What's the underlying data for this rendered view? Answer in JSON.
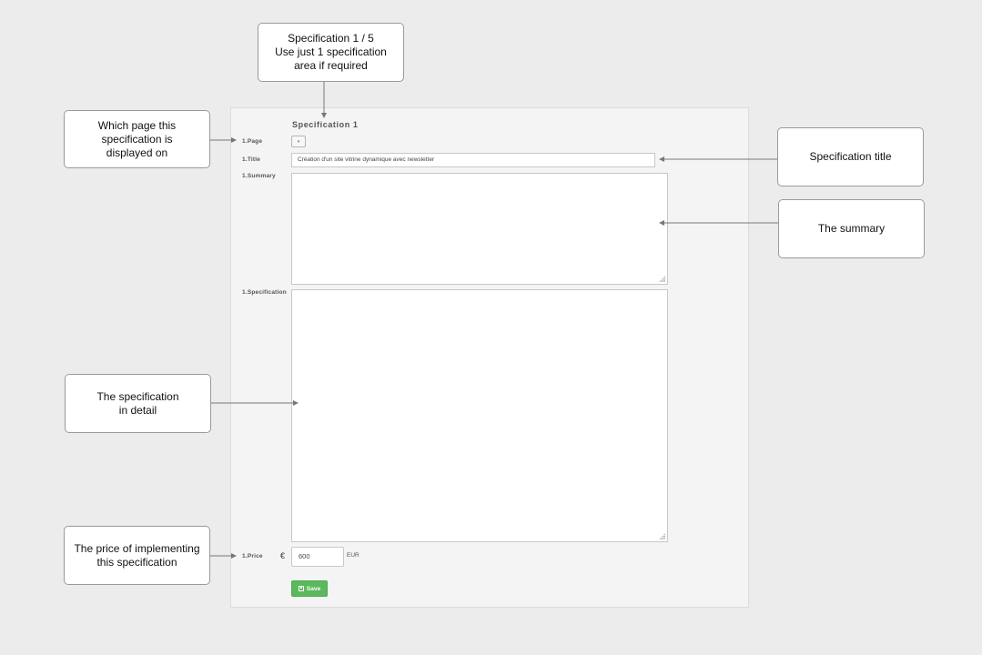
{
  "callouts": {
    "spec_count": "Specification 1 / 5\nUse just 1 specification\narea if required",
    "page": "Which page this\nspecification is\ndisplayed on",
    "title": "Specification title",
    "summary": "The summary",
    "detail": "The specification\nin detail",
    "price": "The price of implementing\nthis specification"
  },
  "form": {
    "heading": "Specification 1",
    "page_label": "1.Page",
    "page_select_caret": "▾",
    "title_label": "1.Title",
    "title_value": "Création d'un site vitrine dynamique avec newsletter",
    "summary_label": "1.Summary",
    "summary_value": "",
    "specification_label": "1.Specification",
    "specification_value": "",
    "price_label": "1.Price",
    "currency_symbol": "€",
    "price_value": "600",
    "currency": "EUR",
    "save_label": "Save"
  },
  "colors": {
    "save_button": "#5cb85c",
    "background": "#ececec",
    "arrow": "#777777"
  }
}
